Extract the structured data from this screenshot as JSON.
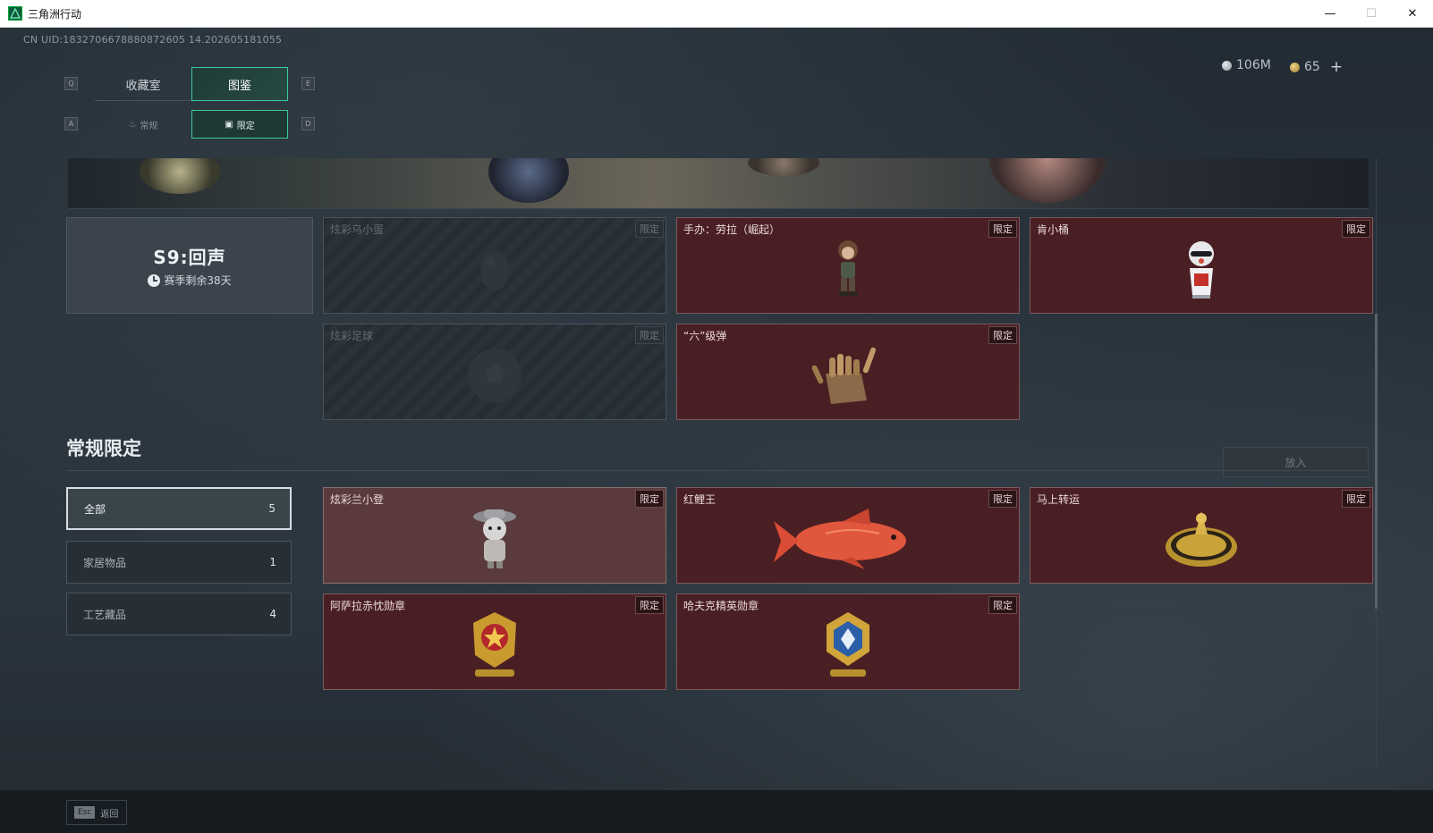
{
  "window": {
    "title": "三角洲行动",
    "minimize": "—",
    "maximize": "☐",
    "close": "✕"
  },
  "uid_text": "CN UID:1832706678880872605 14.202605181055",
  "key_hints": {
    "q": "Q",
    "e": "E",
    "a": "A",
    "d": "D"
  },
  "top_tabs": [
    {
      "label": "收藏室",
      "active": false
    },
    {
      "label": "图鉴",
      "active": true
    }
  ],
  "sub_tabs": [
    {
      "label": "常规",
      "active": false
    },
    {
      "label": "限定",
      "active": true
    }
  ],
  "currency": {
    "silver": "106M",
    "gold": "65",
    "plus": "+"
  },
  "season": {
    "title": "S9:回声",
    "remaining": "赛季剩余38天"
  },
  "season_cards": [
    {
      "name": "炫彩乌小蛋",
      "tag": "限定",
      "locked": true,
      "icon": "egg-icon"
    },
    {
      "name": "手办：劳拉（崛起）",
      "tag": "限定",
      "locked": false,
      "icon": "figure-lara-icon"
    },
    {
      "name": "肯小桶",
      "tag": "限定",
      "locked": false,
      "icon": "figure-bucket-icon"
    },
    {
      "name": "炫彩足球",
      "tag": "限定",
      "locked": true,
      "icon": "football-icon"
    },
    {
      "name": "“六”级弹",
      "tag": "限定",
      "locked": false,
      "icon": "bullet-hand-icon"
    }
  ],
  "section": {
    "title": "常规限定",
    "put_button": "放入"
  },
  "filters": [
    {
      "label": "全部",
      "count": "5",
      "active": true
    },
    {
      "label": "家居物品",
      "count": "1",
      "active": false
    },
    {
      "label": "工艺藏品",
      "count": "4",
      "active": false
    }
  ],
  "regular_cards": [
    {
      "name": "炫彩兰小登",
      "tag": "限定",
      "icon": "figure-landeng-icon"
    },
    {
      "name": "红鲤王",
      "tag": "限定",
      "icon": "red-carp-icon"
    },
    {
      "name": "马上转运",
      "tag": "限定",
      "icon": "lucky-wheel-icon"
    },
    {
      "name": "阿萨拉赤忱勋章",
      "tag": "限定",
      "icon": "red-medal-icon"
    },
    {
      "name": "哈夫克精英勋章",
      "tag": "限定",
      "icon": "blue-medal-icon"
    }
  ],
  "footer": {
    "esc_key": "Esc",
    "esc_label": "返回"
  }
}
